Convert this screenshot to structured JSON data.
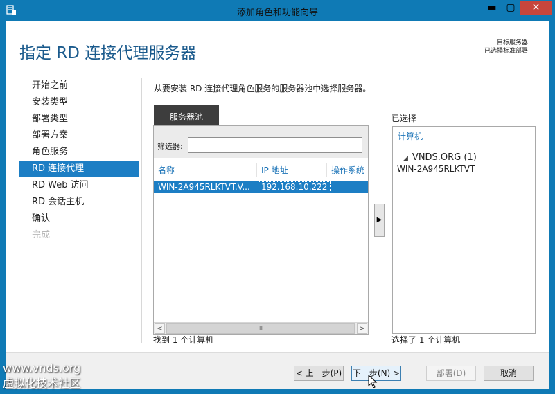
{
  "window": {
    "title": "添加角色和功能向导",
    "min_glyph": "▬",
    "max_glyph": "▢",
    "close_glyph": "✕",
    "close_color": "#c7463c"
  },
  "header": {
    "page_title": "指定 RD 连接代理服务器",
    "target_label": "目标服务器",
    "target_value": "已选择标准部署"
  },
  "nav": {
    "items": [
      {
        "label": "开始之前",
        "state": "normal"
      },
      {
        "label": "安装类型",
        "state": "normal"
      },
      {
        "label": "部署类型",
        "state": "normal"
      },
      {
        "label": "部署方案",
        "state": "normal"
      },
      {
        "label": "角色服务",
        "state": "normal"
      },
      {
        "label": "RD 连接代理",
        "state": "active"
      },
      {
        "label": "RD Web 访问",
        "state": "normal"
      },
      {
        "label": "RD 会话主机",
        "state": "normal"
      },
      {
        "label": "确认",
        "state": "normal"
      },
      {
        "label": "完成",
        "state": "disabled"
      }
    ]
  },
  "main": {
    "description": "从要安装 RD 连接代理角色服务的服务器池中选择服务器。",
    "pool_tab": "服务器池",
    "filter_label": "筛选器:",
    "filter_value": "",
    "columns": [
      "名称",
      "IP 地址",
      "操作系统"
    ],
    "rows": [
      {
        "name": "WIN-2A945RLKTVT.V...",
        "ip": "192.168.10.222",
        "os": ""
      }
    ],
    "found_text": "找到 1 个计算机",
    "add_arrow": "▶",
    "scroll_left": "<",
    "scroll_right": ">",
    "scroll_thumb": "III"
  },
  "selected": {
    "label": "已选择",
    "header": "计算机",
    "group_arrow": "◢",
    "group": "VNDS.ORG (1)",
    "server": "WIN-2A945RLKTVT",
    "count_text": "选择了 1 个计算机"
  },
  "footer": {
    "prev_label": "< 上一步(P)",
    "next_label": "下一步(N) >",
    "deploy_label": "部署(D)",
    "cancel_label": "取消"
  },
  "watermark": {
    "line1": "www.vnds.org",
    "line2": "虚拟化技术社区"
  }
}
